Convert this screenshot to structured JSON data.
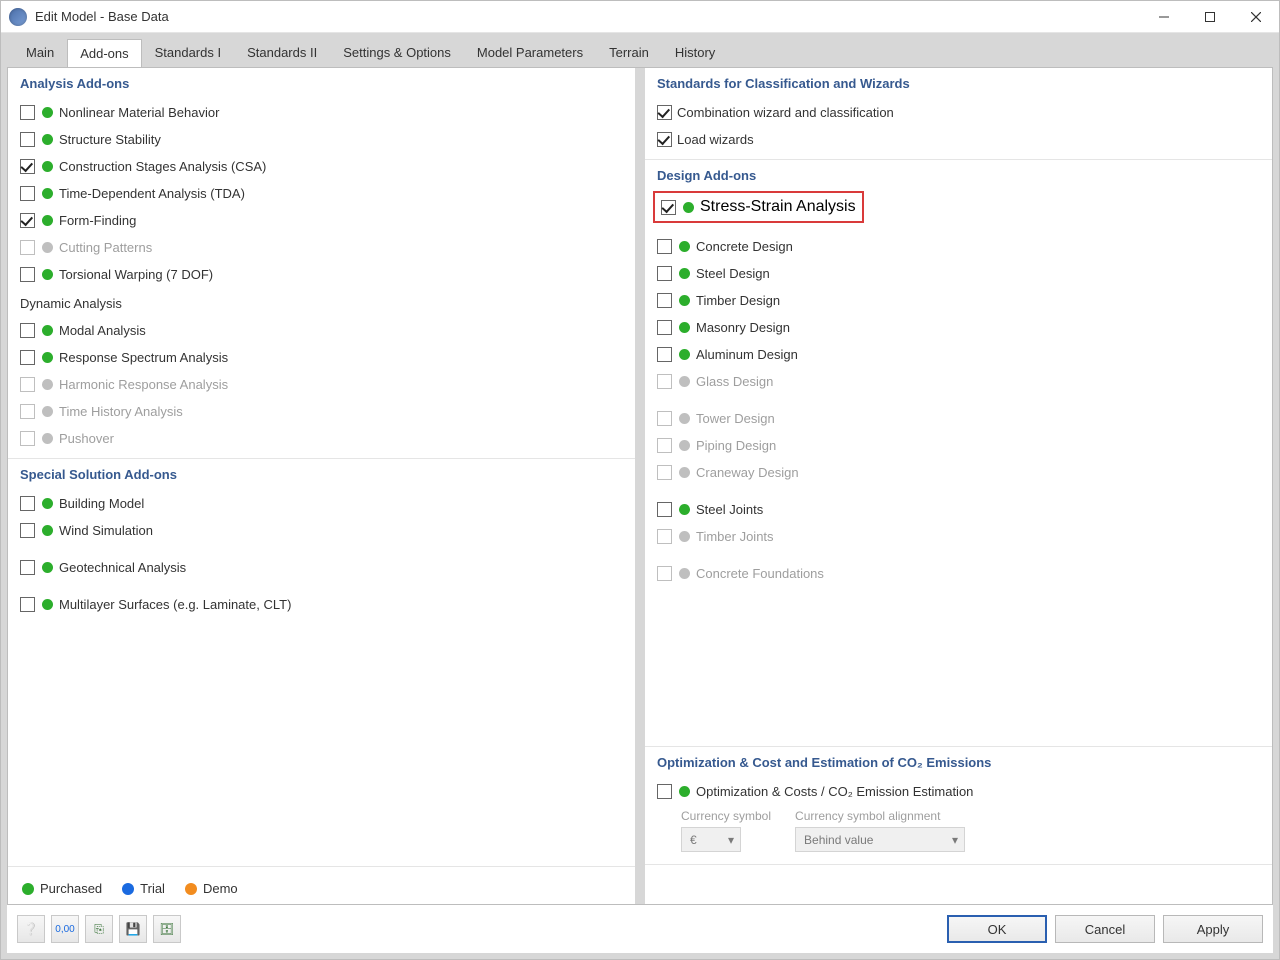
{
  "window": {
    "title": "Edit Model - Base Data"
  },
  "tabs": [
    "Main",
    "Add-ons",
    "Standards I",
    "Standards II",
    "Settings & Options",
    "Model Parameters",
    "Terrain",
    "History"
  ],
  "active_tab": 1,
  "left": {
    "analysis": {
      "title": "Analysis Add-ons",
      "items": [
        {
          "label": "Nonlinear Material Behavior",
          "checked": false,
          "status": "g"
        },
        {
          "label": "Structure Stability",
          "checked": false,
          "status": "g"
        },
        {
          "label": "Construction Stages Analysis (CSA)",
          "checked": true,
          "status": "g"
        },
        {
          "label": "Time-Dependent Analysis (TDA)",
          "checked": false,
          "status": "g"
        },
        {
          "label": "Form-Finding",
          "checked": true,
          "status": "g"
        },
        {
          "label": "Cutting Patterns",
          "checked": false,
          "status": "gd",
          "disabled": true
        },
        {
          "label": "Torsional Warping (7 DOF)",
          "checked": false,
          "status": "g"
        }
      ],
      "dyn_title": "Dynamic Analysis",
      "dyn": [
        {
          "label": "Modal Analysis",
          "checked": false,
          "status": "g"
        },
        {
          "label": "Response Spectrum Analysis",
          "checked": false,
          "status": "g"
        },
        {
          "label": "Harmonic Response Analysis",
          "checked": false,
          "status": "gd",
          "disabled": true
        },
        {
          "label": "Time History Analysis",
          "checked": false,
          "status": "gd",
          "disabled": true
        },
        {
          "label": "Pushover",
          "checked": false,
          "status": "gd",
          "disabled": true
        }
      ]
    },
    "special": {
      "title": "Special Solution Add-ons",
      "items": [
        {
          "label": "Building Model",
          "checked": false,
          "status": "g"
        },
        {
          "label": "Wind Simulation",
          "checked": false,
          "status": "g"
        },
        {
          "label": "Geotechnical Analysis",
          "checked": false,
          "status": "g",
          "gap": true
        },
        {
          "label": "Multilayer Surfaces (e.g. Laminate, CLT)",
          "checked": false,
          "status": "g",
          "gap": true
        }
      ]
    }
  },
  "right": {
    "standards": {
      "title": "Standards for Classification and Wizards",
      "items": [
        {
          "label": "Combination wizard and classification",
          "checked": true
        },
        {
          "label": "Load wizards",
          "checked": true
        }
      ]
    },
    "design": {
      "title": "Design Add-ons",
      "highlight": {
        "label": "Stress-Strain Analysis",
        "checked": true,
        "status": "g"
      },
      "groups": [
        [
          {
            "label": "Concrete Design",
            "checked": false,
            "status": "g"
          },
          {
            "label": "Steel Design",
            "checked": false,
            "status": "g"
          },
          {
            "label": "Timber Design",
            "checked": false,
            "status": "g"
          },
          {
            "label": "Masonry Design",
            "checked": false,
            "status": "g"
          },
          {
            "label": "Aluminum Design",
            "checked": false,
            "status": "g"
          },
          {
            "label": "Glass Design",
            "checked": false,
            "status": "gd",
            "disabled": true
          }
        ],
        [
          {
            "label": "Tower Design",
            "checked": false,
            "status": "gd",
            "disabled": true
          },
          {
            "label": "Piping Design",
            "checked": false,
            "status": "gd",
            "disabled": true
          },
          {
            "label": "Craneway Design",
            "checked": false,
            "status": "gd",
            "disabled": true
          }
        ],
        [
          {
            "label": "Steel Joints",
            "checked": false,
            "status": "g"
          },
          {
            "label": "Timber Joints",
            "checked": false,
            "status": "gd",
            "disabled": true
          }
        ],
        [
          {
            "label": "Concrete Foundations",
            "checked": false,
            "status": "gd",
            "disabled": true
          }
        ]
      ]
    },
    "opt": {
      "title": "Optimization & Cost and Estimation of CO₂ Emissions",
      "item": {
        "label": "Optimization & Costs / CO₂ Emission Estimation",
        "checked": false,
        "status": "g"
      },
      "currency_label": "Currency symbol",
      "currency_value": "€",
      "align_label": "Currency symbol alignment",
      "align_value": "Behind value"
    }
  },
  "legend": {
    "purchased": "Purchased",
    "trial": "Trial",
    "demo": "Demo"
  },
  "buttons": {
    "ok": "OK",
    "cancel": "Cancel",
    "apply": "Apply"
  }
}
